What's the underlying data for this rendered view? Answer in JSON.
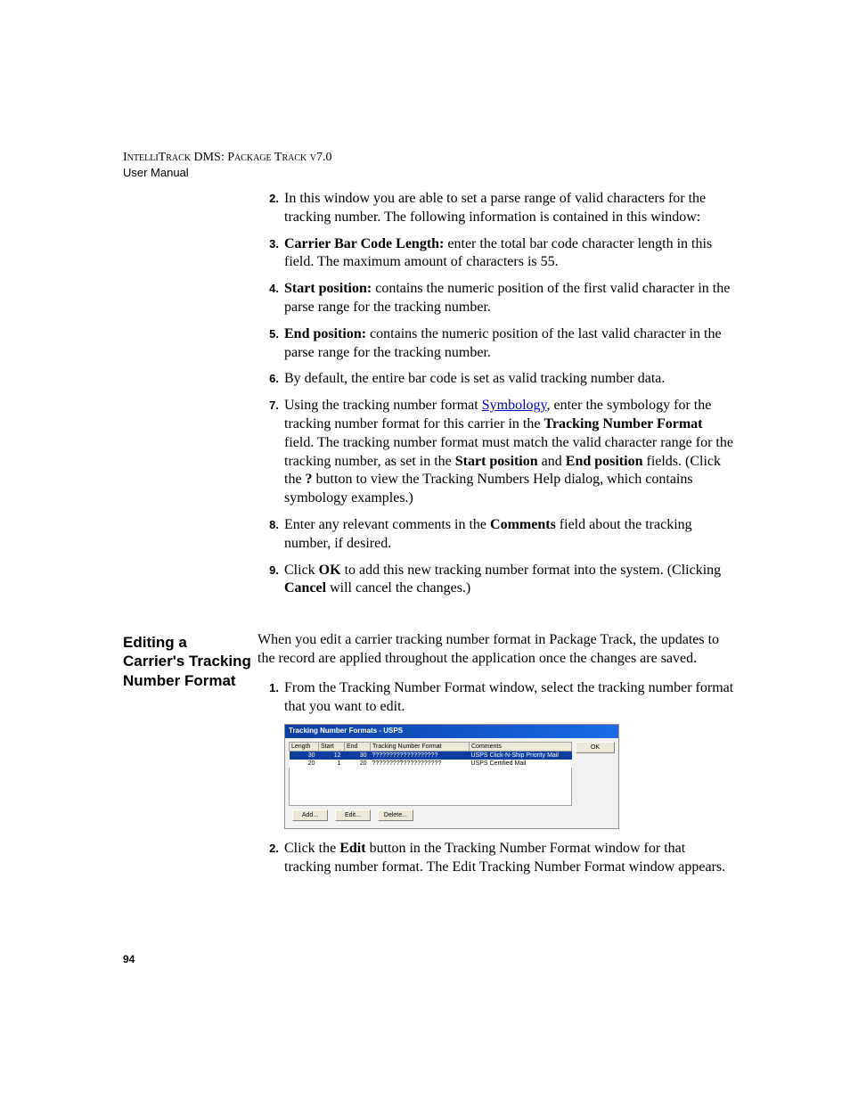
{
  "header": {
    "line1": "IntelliTrack DMS: Package Track v7.0",
    "line2": "User Manual"
  },
  "page_number": "94",
  "section1": {
    "items": [
      {
        "n": "2.",
        "parts": [
          {
            "t": "In this window you are able to set a parse range of valid characters for the tracking number. The following information is contained in this window:"
          }
        ]
      },
      {
        "n": "3.",
        "parts": [
          {
            "t": "Carrier Bar Code Length: ",
            "b": true
          },
          {
            "t": "enter the total bar code character length in this field. The maximum amount of characters is 55."
          }
        ]
      },
      {
        "n": "4.",
        "parts": [
          {
            "t": "Start position: ",
            "b": true
          },
          {
            "t": "contains the numeric position of the first valid character in the parse range for the tracking number."
          }
        ]
      },
      {
        "n": "5.",
        "parts": [
          {
            "t": "End position: ",
            "b": true
          },
          {
            "t": "contains the numeric position of the last valid character in the parse range for the tracking number."
          }
        ]
      },
      {
        "n": "6.",
        "parts": [
          {
            "t": "By default, the entire bar code is set as valid tracking number data."
          }
        ]
      },
      {
        "n": "7.",
        "parts": [
          {
            "t": "Using the tracking number format "
          },
          {
            "t": "Symbology",
            "link": true
          },
          {
            "t": ", enter the symbology for the tracking number format for this carrier in the "
          },
          {
            "t": "Tracking Number Format",
            "b": true
          },
          {
            "t": " field. The tracking number format must match the valid character range for the tracking number, as set in the "
          },
          {
            "t": "Start position",
            "b": true
          },
          {
            "t": " and "
          },
          {
            "t": "End position",
            "b": true
          },
          {
            "t": " fields. (Click the "
          },
          {
            "t": "?",
            "b": true
          },
          {
            "t": " button to view the Tracking Numbers Help dialog, which contains symbology examples.)"
          }
        ]
      },
      {
        "n": "8.",
        "parts": [
          {
            "t": "Enter any relevant comments in the "
          },
          {
            "t": "Comments",
            "b": true
          },
          {
            "t": " field about the tracking number, if desired."
          }
        ]
      },
      {
        "n": "9.",
        "parts": [
          {
            "t": " Click "
          },
          {
            "t": "OK",
            "b": true
          },
          {
            "t": " to add this new tracking number format into the system. (Clicking "
          },
          {
            "t": "Cancel",
            "b": true
          },
          {
            "t": " will cancel the changes.)"
          }
        ]
      }
    ]
  },
  "section2": {
    "heading": "Editing a Carrier's Tracking Number Format",
    "intro": "When you edit a carrier tracking number format in Package Track, the updates to the record are applied throughout the application once the changes are saved.",
    "step1": {
      "n": "1.",
      "text": "From the Tracking Number Format window, select the tracking number format that you want to edit."
    },
    "step2": {
      "n": "2.",
      "parts": [
        {
          "t": "Click the "
        },
        {
          "t": "Edit",
          "b": true
        },
        {
          "t": " button in the Tracking Number Format window for that tracking number format. The Edit Tracking Number Format window appears."
        }
      ]
    }
  },
  "window": {
    "title": "Tracking Number Formats - USPS",
    "cols": {
      "length": "Length",
      "start": "Start",
      "end": "End",
      "format": "Tracking Number Format",
      "comments": "Comments"
    },
    "rows": [
      {
        "length": "30",
        "start": "12",
        "end": "30",
        "format": "???????????????????",
        "comments": "USPS Click-N-Ship Priority Mail",
        "sel": true
      },
      {
        "length": "20",
        "start": "1",
        "end": "20",
        "format": "????????????????????",
        "comments": "USPS Certified Mail",
        "sel": false
      }
    ],
    "buttons": {
      "ok": "OK",
      "add": "Add...",
      "edit": "Edit...",
      "del": "Delete..."
    }
  }
}
